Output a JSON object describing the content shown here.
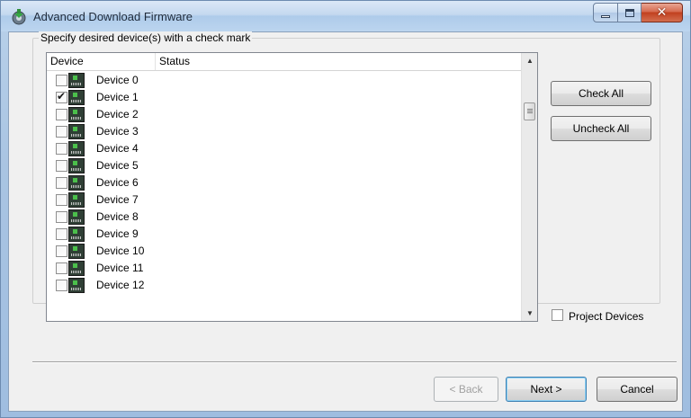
{
  "window": {
    "title": "Advanced Download Firmware",
    "icon": "download-firmware-icon"
  },
  "group": {
    "legend": "Specify desired device(s) with a check mark"
  },
  "list": {
    "columns": [
      "Device",
      "Status"
    ],
    "rows": [
      {
        "label": "Device 0",
        "checked": false
      },
      {
        "label": "Device 1",
        "checked": true
      },
      {
        "label": "Device 2",
        "checked": false
      },
      {
        "label": "Device 3",
        "checked": false
      },
      {
        "label": "Device 4",
        "checked": false
      },
      {
        "label": "Device 5",
        "checked": false
      },
      {
        "label": "Device 6",
        "checked": false
      },
      {
        "label": "Device 7",
        "checked": false
      },
      {
        "label": "Device 8",
        "checked": false
      },
      {
        "label": "Device 9",
        "checked": false
      },
      {
        "label": "Device 10",
        "checked": false
      },
      {
        "label": "Device 11",
        "checked": false
      },
      {
        "label": "Device 12",
        "checked": false
      }
    ]
  },
  "buttons": {
    "check_all": "Check All",
    "uncheck_all": "Uncheck All",
    "back": "< Back",
    "next": "Next >",
    "cancel": "Cancel"
  },
  "options": {
    "project_devices_label": "Project Devices",
    "project_devices_checked": false
  }
}
